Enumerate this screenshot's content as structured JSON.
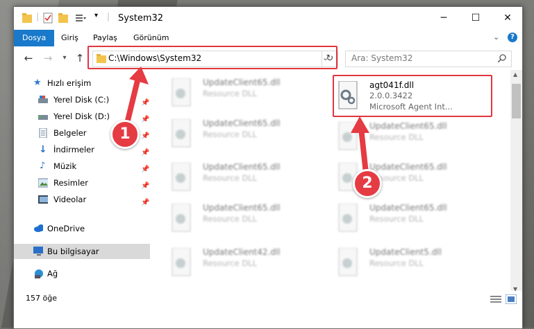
{
  "window": {
    "title": "System32",
    "controls": {
      "minimize": "─",
      "maximize": "☐",
      "close": "✕"
    }
  },
  "ribbon": {
    "tabs": [
      "Dosya",
      "Giriş",
      "Paylaş",
      "Görünüm"
    ],
    "expand_icon": "chevron-down-icon",
    "help_label": "?"
  },
  "nav": {
    "back": "←",
    "forward": "→",
    "recent": "▾",
    "up": "↑",
    "address": "C:\\Windows\\System32",
    "refresh": "↻",
    "search_placeholder": "Ara: System32"
  },
  "sidebar": {
    "quick_access": "Hızlı erişim",
    "items": [
      {
        "label": "Yerel Disk (C:)",
        "icon": "drive-icon",
        "pinned": true
      },
      {
        "label": "Yerel Disk (D:)",
        "icon": "drive-icon",
        "pinned": true
      },
      {
        "label": "Belgeler",
        "icon": "documents-icon",
        "pinned": true
      },
      {
        "label": "İndirmeler",
        "icon": "downloads-icon",
        "pinned": true
      },
      {
        "label": "Müzik",
        "icon": "music-icon",
        "pinned": true
      },
      {
        "label": "Resimler",
        "icon": "pictures-icon",
        "pinned": true
      },
      {
        "label": "Videolar",
        "icon": "videos-icon",
        "pinned": true
      }
    ],
    "onedrive": "OneDrive",
    "this_pc": "Bu bilgisayar",
    "network": "Ağ"
  },
  "files": {
    "left_column": [
      {
        "name": "UpdateClient65.dll",
        "desc": "Resource DLL"
      },
      {
        "name": "UpdateClient65.dll",
        "desc": "Resource DLL"
      },
      {
        "name": "UpdateClient65.dll",
        "desc": "Resource DLL"
      },
      {
        "name": "UpdateClient65.dll",
        "desc": "Resource DLL"
      },
      {
        "name": "UpdateClient42.dll",
        "desc": "Resource DLL"
      }
    ],
    "right_column": [
      {
        "name": "UpdateClient65.dll",
        "desc": "Resource DLL"
      },
      {
        "name": "UpdateClient65.dll",
        "desc": "Resource DLL"
      },
      {
        "name": "UpdateClient65.dll",
        "desc": "Resource DLL"
      },
      {
        "name": "UpdateClient5.dll",
        "desc": "Resource DLL"
      }
    ],
    "selected": {
      "name": "agt041f.dll",
      "version": "2.0.0.3422",
      "desc": "Microsoft Agent Int..."
    }
  },
  "status": {
    "count": "157 öğe"
  },
  "callouts": {
    "one": "1",
    "two": "2"
  },
  "colors": {
    "accent": "#1979ca",
    "highlight": "#e0363f",
    "badge": "#e53b43"
  }
}
